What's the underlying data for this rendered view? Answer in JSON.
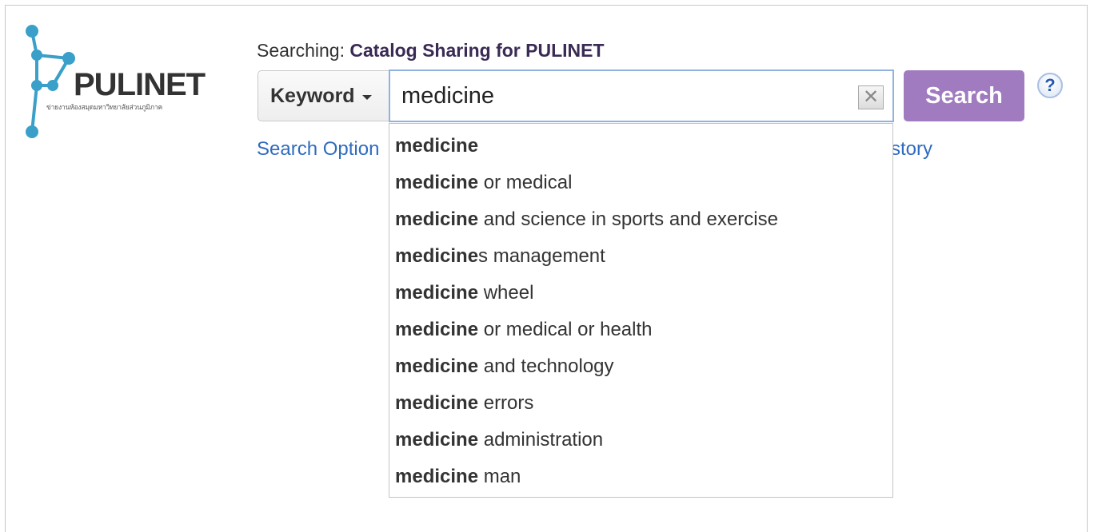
{
  "logo": {
    "name": "PULINET",
    "tagline": "ข่ายงานห้องสมุดมหาวิทยาลัยส่วนภูมิภาค"
  },
  "header": {
    "searching_prefix": "Searching:",
    "database_name": "Catalog Sharing for PULINET"
  },
  "search": {
    "field_label": "Keyword",
    "query": "medicine",
    "clear_symbol": "✕",
    "submit_label": "Search",
    "help_symbol": "?"
  },
  "links": {
    "search_options_partial": "Search Option",
    "history_partial": "story"
  },
  "autocomplete": [
    {
      "match": "medicine",
      "rest": ""
    },
    {
      "match": "medicine",
      "rest": " or medical"
    },
    {
      "match": "medicine",
      "rest": " and science in sports and exercise"
    },
    {
      "match": "medicine",
      "rest": "s management"
    },
    {
      "match": "medicine",
      "rest": " wheel"
    },
    {
      "match": "medicine",
      "rest": " or medical or health"
    },
    {
      "match": "medicine",
      "rest": " and technology"
    },
    {
      "match": "medicine",
      "rest": " errors"
    },
    {
      "match": "medicine",
      "rest": " administration"
    },
    {
      "match": "medicine",
      "rest": " man"
    }
  ],
  "icons": {
    "logo": "network-nodes-logo-icon",
    "field_dropdown": "caret-down-icon",
    "clear": "clear-x-icon",
    "help": "help-question-icon"
  },
  "colors": {
    "search_button": "#a07bbf",
    "link": "#2f6bbf",
    "logo_nodes": "#3ba0c9",
    "input_focus_border": "#8fb3de"
  }
}
